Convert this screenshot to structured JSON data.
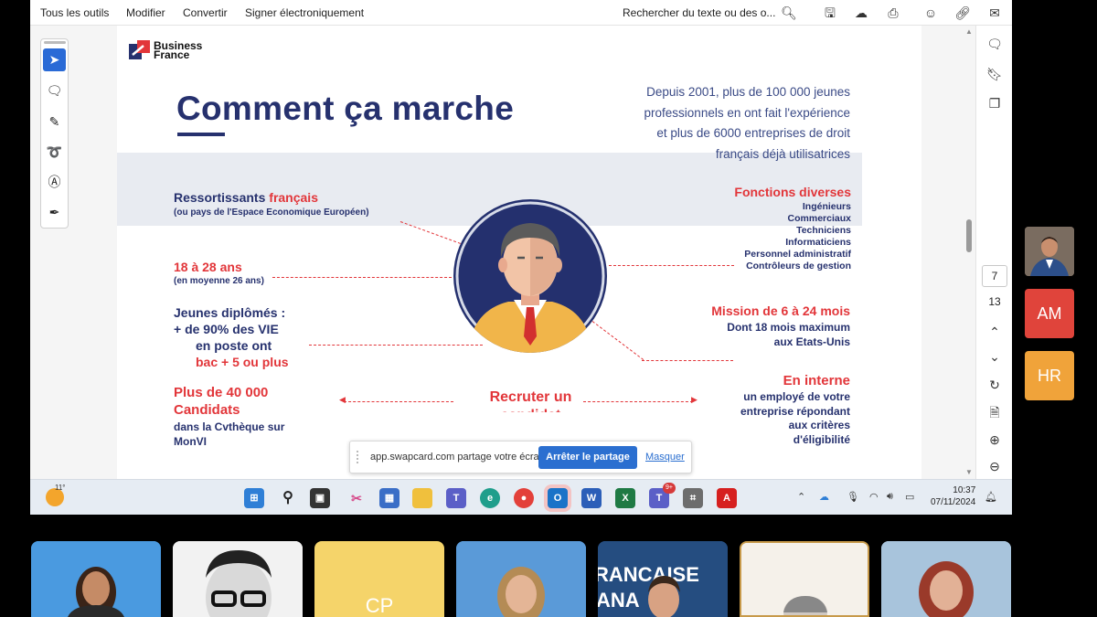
{
  "menu": [
    "Tous les outils",
    "Modifier",
    "Convertir",
    "Signer électroniquement"
  ],
  "search_placeholder": "Rechercher du texte ou des o...",
  "toolbar_icons": [
    "search-icon",
    "save-icon",
    "upload-icon",
    "print-icon",
    "account-icon",
    "link-icon",
    "mail-icon"
  ],
  "left_tools": [
    "select-arrow-icon",
    "comment-icon",
    "highlight-pen-icon",
    "draw-lasso-icon",
    "text-box-icon",
    "sign-icon"
  ],
  "right_rail_icons": [
    "comment-panel-icon",
    "bookmark-icon",
    "pages-icon",
    "chevron-up-icon",
    "chevron-down-icon",
    "rotate-icon",
    "page-settings-icon",
    "zoom-in-icon",
    "zoom-out-icon"
  ],
  "pager": {
    "current": "7",
    "total": "13"
  },
  "slide": {
    "logo_line1": "Business",
    "logo_line2": "France",
    "title": "Comment ça marche",
    "intro": [
      "Depuis 2001, plus de 100 000 jeunes",
      "professionnels en ont fait l'expérience",
      "et plus de 6000 entreprises de droit",
      "français déjà utilisatrices"
    ],
    "left1_a": "Ressortissants ",
    "left1_b": "français",
    "left1_sub": "(ou pays de l'Espace Economique Européen)",
    "left2": "18 à 28 ans",
    "left2_sub": "(en moyenne 26 ans)",
    "left3": [
      "Jeunes diplômés :",
      "+ de 90% des VIE",
      "en poste ont",
      "bac + 5 ou plus"
    ],
    "left4": [
      "Plus de 40 000",
      "Candidats"
    ],
    "left4_sub": [
      "dans la Cvthèque sur",
      "MonVI"
    ],
    "right1": "Fonctions diverses",
    "right1_list": [
      "Ingénieurs",
      "Commerciaux",
      "Techniciens",
      "Informaticiens",
      "Personnel administratif",
      "Contrôleurs de gestion"
    ],
    "right2": "Mission de 6 à 24 mois",
    "right2_sub": [
      "Dont 18 mois maximum",
      "aux Etats-Unis"
    ],
    "right3": "En interne",
    "right3_sub": [
      "un employé de votre",
      "entreprise répondant",
      "aux critères",
      "d'éligibilité"
    ],
    "center": [
      "Recruter un",
      "candidat"
    ],
    "page_number": "7"
  },
  "share_banner": {
    "text": "app.swapcard.com partage votre écran.",
    "stop": "Arrêter le partage",
    "hide": "Masquer"
  },
  "taskbar": {
    "temperature": "11°",
    "apps": [
      "windows-start-icon",
      "search-icon",
      "task-view-icon",
      "snipping-tool-icon",
      "store-icon",
      "file-explorer-icon",
      "teams-icon",
      "edge-icon",
      "chrome-icon",
      "outlook-icon",
      "word-icon",
      "excel-icon",
      "teams-work-icon",
      "calculator-icon",
      "acrobat-icon"
    ],
    "teams_badge": "9+",
    "time": "10:37",
    "date": "07/11/2024"
  },
  "participants_side": [
    "AM",
    "HR"
  ],
  "participants_bottom_initials": "CP",
  "colors": {
    "navy": "#26316e",
    "red": "#e2363a",
    "am": "#e0443b",
    "hr": "#f0a33a",
    "cp": "#f5d46a"
  }
}
